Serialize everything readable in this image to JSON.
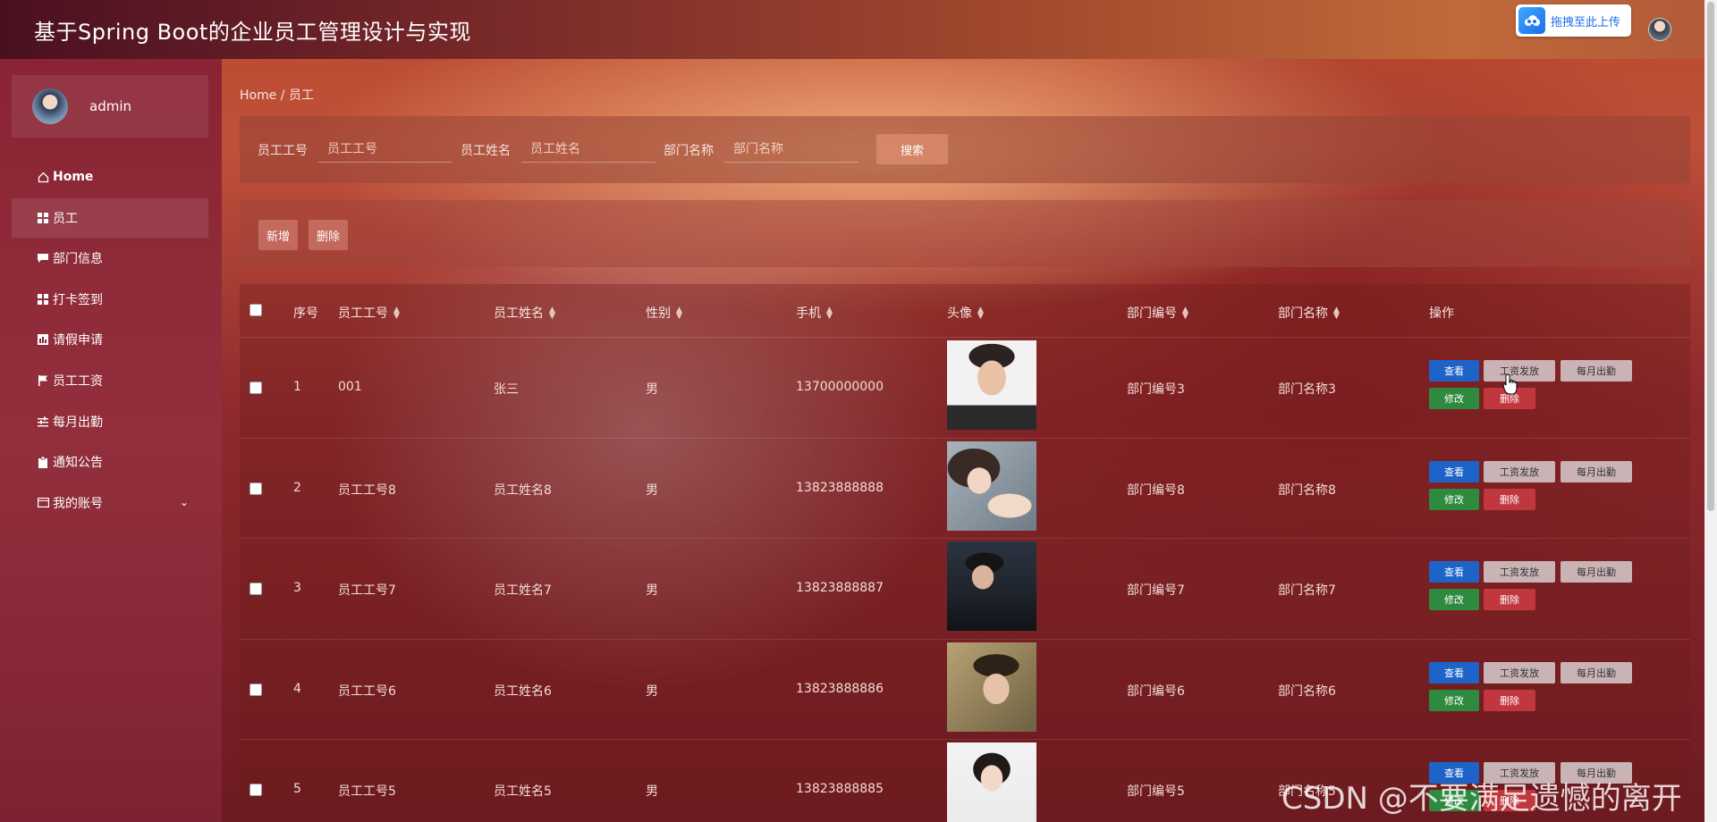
{
  "app": {
    "title": "基于Spring Boot的企业员工管理设计与实现"
  },
  "topbar": {
    "upload_label": "拖拽至此上传"
  },
  "sidebar": {
    "user_name": "admin",
    "items": [
      {
        "label": "Home",
        "icon": "home-icon"
      },
      {
        "label": "员工",
        "icon": "grid-icon"
      },
      {
        "label": "部门信息",
        "icon": "chat-icon"
      },
      {
        "label": "打卡签到",
        "icon": "grid-icon"
      },
      {
        "label": "请假申请",
        "icon": "chart-icon"
      },
      {
        "label": "员工工资",
        "icon": "flag-icon"
      },
      {
        "label": "每月出勤",
        "icon": "sliders-icon"
      },
      {
        "label": "通知公告",
        "icon": "clipboard-icon"
      },
      {
        "label": "我的账号",
        "icon": "id-card-icon"
      }
    ]
  },
  "breadcrumb": "Home / 员工",
  "search": {
    "fields": [
      {
        "label": "员工工号",
        "placeholder": "员工工号"
      },
      {
        "label": "员工姓名",
        "placeholder": "员工姓名"
      },
      {
        "label": "部门名称",
        "placeholder": "部门名称"
      }
    ],
    "button": "搜索"
  },
  "actions": {
    "add": "新增",
    "delete": "删除"
  },
  "table": {
    "headers": {
      "index": "序号",
      "emp_no": "员工工号",
      "name": "员工姓名",
      "gender": "性别",
      "phone": "手机",
      "avatar": "头像",
      "dept_no": "部门编号",
      "dept_name": "部门名称",
      "ops": "操作"
    },
    "op_labels": {
      "view": "查看",
      "salary": "工资发放",
      "attendance": "每月出勤",
      "edit": "修改",
      "delete": "删除"
    },
    "rows": [
      {
        "index": "1",
        "emp_no": "001",
        "name": "张三",
        "gender": "男",
        "phone": "13700000000",
        "dept_no": "部门编号3",
        "dept_name": "部门名称3"
      },
      {
        "index": "2",
        "emp_no": "员工工号8",
        "name": "员工姓名8",
        "gender": "男",
        "phone": "13823888888",
        "dept_no": "部门编号8",
        "dept_name": "部门名称8"
      },
      {
        "index": "3",
        "emp_no": "员工工号7",
        "name": "员工姓名7",
        "gender": "男",
        "phone": "13823888887",
        "dept_no": "部门编号7",
        "dept_name": "部门名称7"
      },
      {
        "index": "4",
        "emp_no": "员工工号6",
        "name": "员工姓名6",
        "gender": "男",
        "phone": "13823888886",
        "dept_no": "部门编号6",
        "dept_name": "部门名称6"
      },
      {
        "index": "5",
        "emp_no": "员工工号5",
        "name": "员工姓名5",
        "gender": "男",
        "phone": "13823888885",
        "dept_no": "部门编号5",
        "dept_name": "部门名称5"
      }
    ]
  },
  "watermark": "CSDN @不要满足遗憾的离开"
}
